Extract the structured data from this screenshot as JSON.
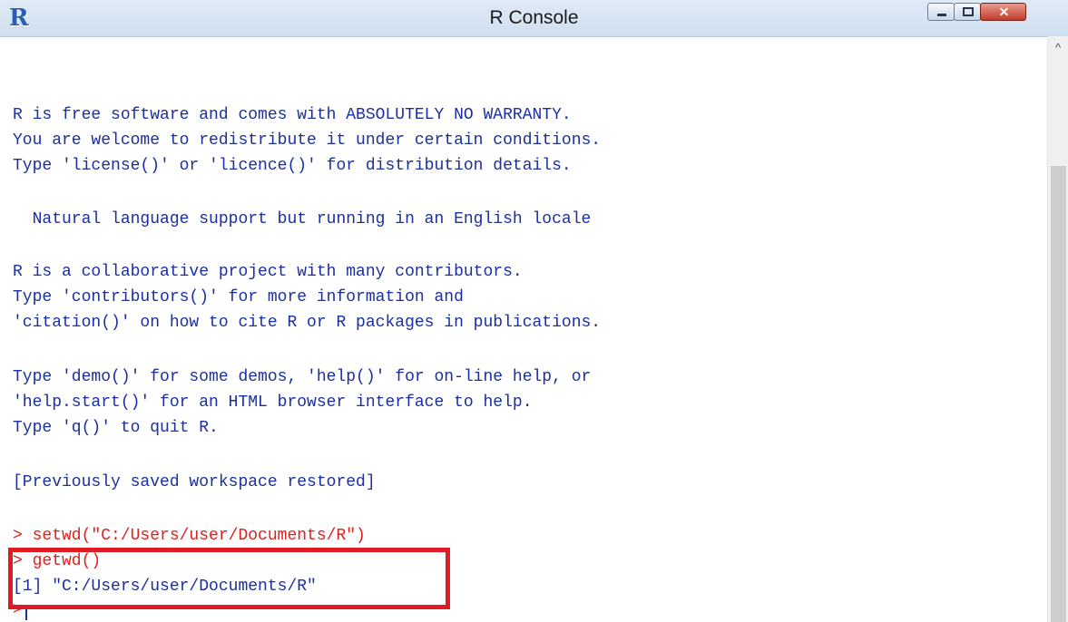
{
  "window": {
    "title": "R Console",
    "app_icon": "R",
    "close_label": "✕"
  },
  "console": {
    "lines": [
      "R is free software and comes with ABSOLUTELY NO WARRANTY.",
      "You are welcome to redistribute it under certain conditions.",
      "Type 'license()' or 'licence()' for distribution details.",
      "  Natural language support but running in an English locale",
      "R is a collaborative project with many contributors.",
      "Type 'contributors()' for more information and",
      "'citation()' on how to cite R or R packages in publications.",
      "Type 'demo()' for some demos, 'help()' for on-line help, or",
      "'help.start()' for an HTML browser interface to help.",
      "Type 'q()' to quit R.",
      "[Previously saved workspace restored]",
      "> setwd(\"C:/Users/user/Documents/R\")",
      "> getwd()",
      "[1] \"C:/Users/user/Documents/R\"",
      "> "
    ]
  },
  "colors": {
    "output_text": "#1a2fa0",
    "command_text": "#e0201c",
    "highlight_box": "#e01b24"
  },
  "scrollbar": {
    "up_arrow": "^"
  }
}
